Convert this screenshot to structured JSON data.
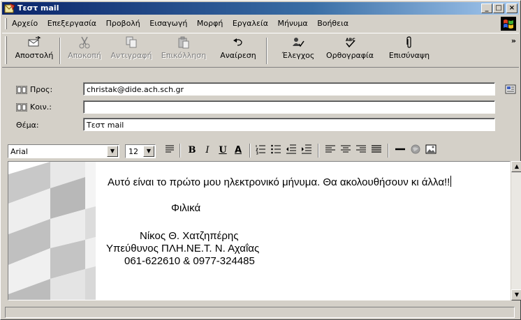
{
  "window": {
    "title": "Τεστ mail",
    "controls": {
      "minimize": "_",
      "maximize": "□",
      "close": "×"
    }
  },
  "menu": [
    {
      "label": "Αρχείο"
    },
    {
      "label": "Επεξεργασία"
    },
    {
      "label": "Προβολή"
    },
    {
      "label": "Εισαγωγή"
    },
    {
      "label": "Μορφή"
    },
    {
      "label": "Εργαλεία"
    },
    {
      "label": "Μήνυμα"
    },
    {
      "label": "Βοήθεια"
    }
  ],
  "toolbar": {
    "send": "Αποστολή",
    "cut": "Αποκοπή",
    "copy": "Αντιγραφή",
    "paste": "Επικόλληση",
    "undo": "Αναίρεση",
    "check": "Έλεγχος",
    "spelling": "Ορθογραφία",
    "attach": "Επισύναψη",
    "more": "»"
  },
  "header": {
    "to_label": "Προς:",
    "to_value": "christak@dide.ach.sch.gr",
    "cc_label": "Κοιν.:",
    "cc_value": "",
    "subject_label": "Θέμα:",
    "subject_value": "Τεστ mail"
  },
  "format": {
    "font": "Arial",
    "size": "12",
    "bold": "B",
    "italic": "I",
    "underline": "U",
    "font_color": "A"
  },
  "message": {
    "line1": "Αυτό είναι το πρώτο μου ηλεκτρονικό μήνυμα. Θα ακολουθήσουν κι άλλα!!",
    "line2": "Φιλικά",
    "line3": "Νίκος Θ. Χατζηπέρης",
    "line4": "Υπεύθυνος ΠΛΗ.ΝΕ.Τ. Ν. Αχαΐας",
    "line5": "061-622610 & 0977-324485"
  },
  "colors": {
    "title_bar_start": "#0a246a",
    "title_bar_end": "#a6caf0",
    "face": "#d4d0c8"
  },
  "icons": [
    "app-mail-icon",
    "send-icon",
    "cut-icon",
    "copy-icon",
    "paste-icon",
    "undo-icon",
    "check-names-icon",
    "spelling-icon",
    "paperclip-icon",
    "address-book-icon",
    "windows-logo-icon"
  ]
}
